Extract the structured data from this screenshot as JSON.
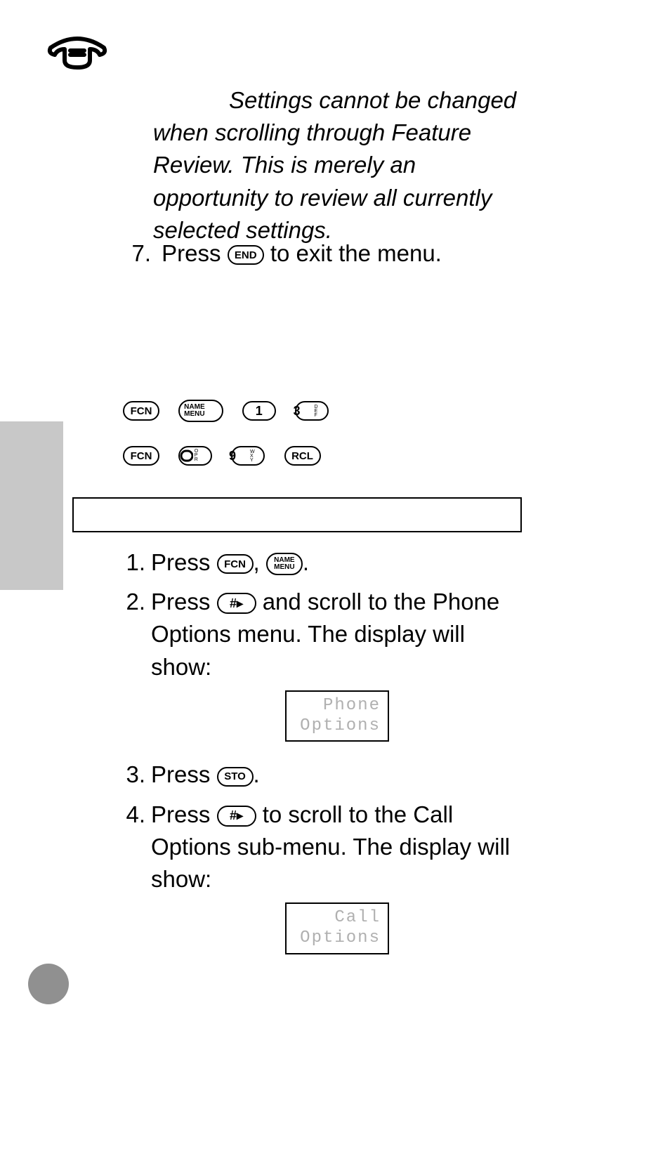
{
  "section_top": {
    "note_italic": "Settings cannot be changed when scrolling through Feature Review. This is merely an opportunity to review all currently selected settings.",
    "step7_prefix": "7.",
    "step7_a": "Press ",
    "step7_key": "END",
    "step7_b": " to exit the menu."
  },
  "keys": {
    "fcn": "FCN",
    "name": "NAME",
    "menu": "MENU",
    "one": "1",
    "three": "3",
    "three_sub": "DEF",
    "zero_sub": "OPR",
    "nine": "9",
    "nine_sub": "WXY",
    "rcl": "RCL",
    "end": "END",
    "sto": "STO",
    "hash": "#▸"
  },
  "section_box": "",
  "steps": {
    "s1_num": "1.",
    "s1_a": "Press ",
    "s1_b": ", ",
    "s1_c": ".",
    "s2_num": "2.",
    "s2_a": "Press ",
    "s2_b": " and scroll to the Phone Options menu. The display will show:",
    "s3_num": "3.",
    "s3_a": "Press ",
    "s3_b": ".",
    "s4_num": "4.",
    "s4_a": "Press ",
    "s4_b": " to scroll to the Call Options sub-menu. The display will show:"
  },
  "displays": {
    "d1_l1": "Phone",
    "d1_l2": "Options",
    "d2_l1": "Call",
    "d2_l2": "Options"
  }
}
